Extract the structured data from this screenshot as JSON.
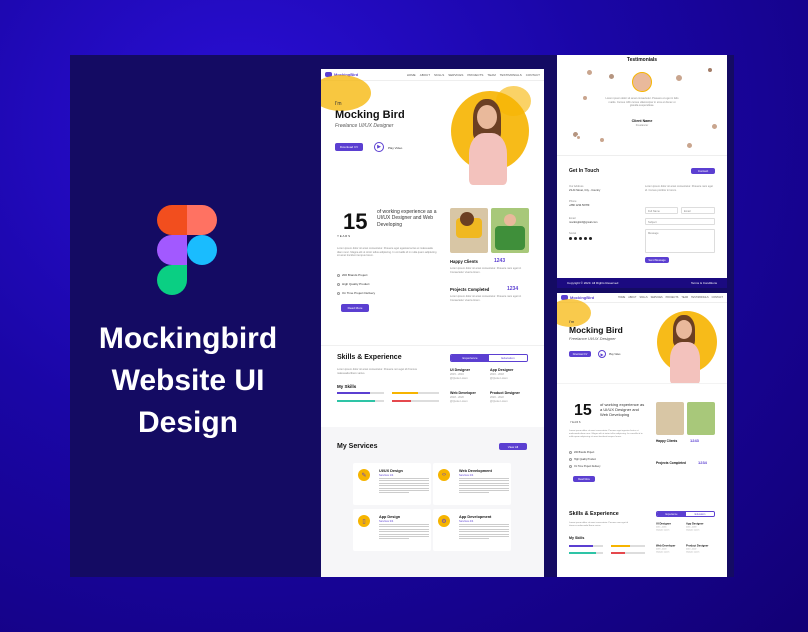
{
  "title": {
    "line1": "Mockingbird",
    "line2": "Website UI",
    "line3": "Design"
  },
  "site": {
    "logo_text": "MockingBird",
    "nav": [
      "HOME",
      "ABOUT",
      "SKILLS",
      "SERVICES",
      "PROJECTS",
      "TEAM",
      "TESTIMONIALS",
      "CONTACT"
    ],
    "hero": {
      "greeting": "I'm",
      "name": "Mocking Bird",
      "role": "Freelance UI/UX Designer",
      "download_label": "Download CV",
      "play_label": "Play Video"
    },
    "about": {
      "years": "15",
      "years_caption": "Y E A R S",
      "experience_text": "of working experience as a UI/UX Designer and Web Developing",
      "desc": "Lorem ipsum dolor sit amet consectetur. Posuere eget egestas lectus et malesuada diam nunc. Magna elit ut tortor tellus adipiscing. In convallis id in nulla quam adipiscing sit amet tincidunt tempus lorem.",
      "checks": [
        "200 Brands Project",
        "High Quality Product",
        "On Time Project Delivery"
      ],
      "read_more": "Read More",
      "happy_clients_label": "Happy Clients",
      "happy_clients_value": "1243",
      "projects_label": "Projects Completed",
      "projects_value": "1234",
      "stat_desc": "Lorem ipsum dolor sit amet consectetur. Posuere nam eget id. Consectetur viverra lorem."
    },
    "skills": {
      "title": "Skills & Experience",
      "desc": "Lorem ipsum dolor sit amet consectetur. Posuere non eget id rhoncus malesuada libero varius.",
      "tab_active": "Experience",
      "tab_other": "Education",
      "my_skills": "My Skills",
      "bars": [
        {
          "color": "#5b3fd1",
          "fill": 0.7
        },
        {
          "color": "#f6b400",
          "fill": 0.55
        },
        {
          "color": "#2ec4a6",
          "fill": 0.8
        },
        {
          "color": "#e5484d",
          "fill": 0.4
        }
      ],
      "jobs": [
        {
          "title": "UI Designer",
          "date": "2015 - 2016",
          "company": "@Quote Lorem"
        },
        {
          "title": "App Designer",
          "date": "2016 - 2018",
          "company": "@Quote Lorem"
        },
        {
          "title": "Web Developer",
          "date": "2018 - 2020",
          "company": "@Quote Lorem"
        },
        {
          "title": "Product Designer",
          "date": "2020 - 2022",
          "company": "@Quote Lorem"
        }
      ]
    },
    "services": {
      "title": "My Services",
      "view_all": "View All",
      "cards": [
        {
          "title": "UI/UX Design",
          "sub": "Services 1/4",
          "icon": "pen-icon"
        },
        {
          "title": "Web Development",
          "sub": "Services 2/4",
          "icon": "code-icon"
        },
        {
          "title": "App Design",
          "sub": "Services 3/4",
          "icon": "phone-icon"
        },
        {
          "title": "App Development",
          "sub": "Services 4/4",
          "icon": "gear-icon"
        }
      ]
    },
    "testimonials": {
      "title": "Testimonials",
      "quote": "Lorem ipsum dolor sit amet consectetur. Posuere et eget in felis mattis. Cursus nibh cursus ullamcorper in eros et donec ut gravida suspendisse.",
      "client_name": "Client Name",
      "client_role": "Freelancer"
    },
    "contact": {
      "title": "Get In Touch",
      "button": "Contact",
      "address_label": "Our Address",
      "address": "23 Ali Street, City - Country",
      "phone_label": "Phone",
      "phone": "+880 1234 56789",
      "email_label": "Email",
      "email": "mockingbird@gmail.com",
      "social_label": "Social",
      "social_icons": [
        "facebook-icon",
        "instagram-icon",
        "twitter-icon",
        "linkedin-icon",
        "dribbble-icon"
      ],
      "form_desc": "Lorem ipsum dolor sit amet consectetur. Posuere nam eget id. Cursus porttitor in lorem.",
      "name_placeholder": "Full Name",
      "email_placeholder": "Email",
      "subject_placeholder": "Subject",
      "message_placeholder": "Message",
      "send_label": "Send Message"
    },
    "footer": {
      "copyright": "Copyright © 2023. All Rights Reserved",
      "terms": "Terms & Conditions"
    }
  }
}
